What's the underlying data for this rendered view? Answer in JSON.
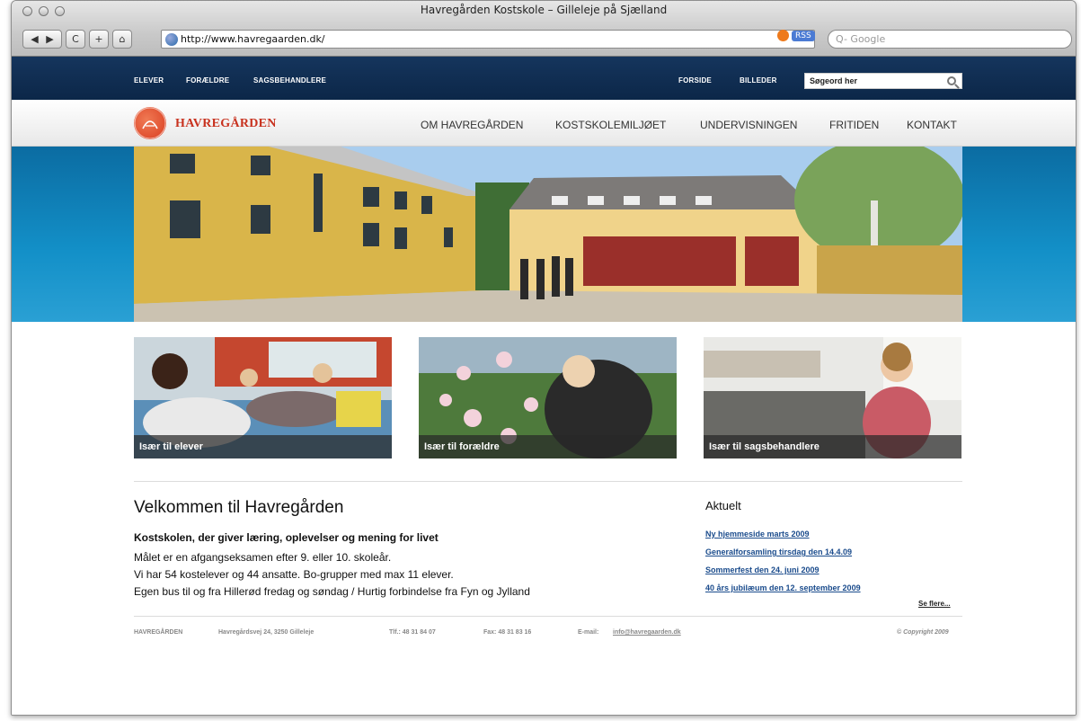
{
  "browser": {
    "window_title": "Havregården Kostskole – Gilleleje på Sjælland",
    "url": "http://www.havregaarden.dk/",
    "search_placeholder": "Q- Google",
    "rss_label": "RSS",
    "toolbar_buttons": [
      "C",
      "+",
      "⌂"
    ]
  },
  "topbar": {
    "left_links": [
      "ELEVER",
      "FORÆLDRE",
      "SAGSBEHANDLERE"
    ],
    "right_links": [
      "FORSIDE",
      "BILLEDER"
    ],
    "search_placeholder": "Søgeord her"
  },
  "brand": {
    "name": "HAVREGÅRDEN",
    "color": "#c8321f"
  },
  "mainnav": [
    "OM HAVREGÅRDEN",
    "KOSTSKOLEMILJØET",
    "UNDERVISNINGEN",
    "FRITIDEN",
    "KONTAKT"
  ],
  "cards": [
    {
      "label": "Især til elever"
    },
    {
      "label": "Især til forældre"
    },
    {
      "label": "Især til sagsbehandlere"
    }
  ],
  "welcome": {
    "title": "Velkommen til Havregården",
    "subtitle": "Kostskolen, der giver læring, oplevelser og mening for livet",
    "lines": [
      "Målet er en afgangseksamen efter 9. eller 10. skoleår.",
      "Vi har 54 kostelever og 44 ansatte. Bo-grupper med max 11 elever.",
      "Egen bus til og fra Hillerød fredag og søndag / Hurtig forbindelse fra Fyn og Jylland"
    ]
  },
  "news": {
    "title": "Aktuelt",
    "items": [
      "Ny hjemmeside marts 2009",
      "Generalforsamling tirsdag den 14.4.09",
      "Sommerfest den 24. juni 2009",
      "40 års jubilæum den 12. september 2009"
    ],
    "more": "Se flere..."
  },
  "footer": {
    "name": "HAVREGÅRDEN",
    "address": "Havregårdsvej 24, 3250 Gilleleje",
    "phone": "Tlf.: 48 31 84 07",
    "fax": "Fax: 48 31 83 16",
    "email_label": "E-mail:",
    "email": "info@havregaarden.dk",
    "copyright": "© Copyright 2009"
  },
  "colors": {
    "topbar": "#0c2748",
    "hero_band": "#1390c8",
    "link": "#1a4b8c"
  }
}
